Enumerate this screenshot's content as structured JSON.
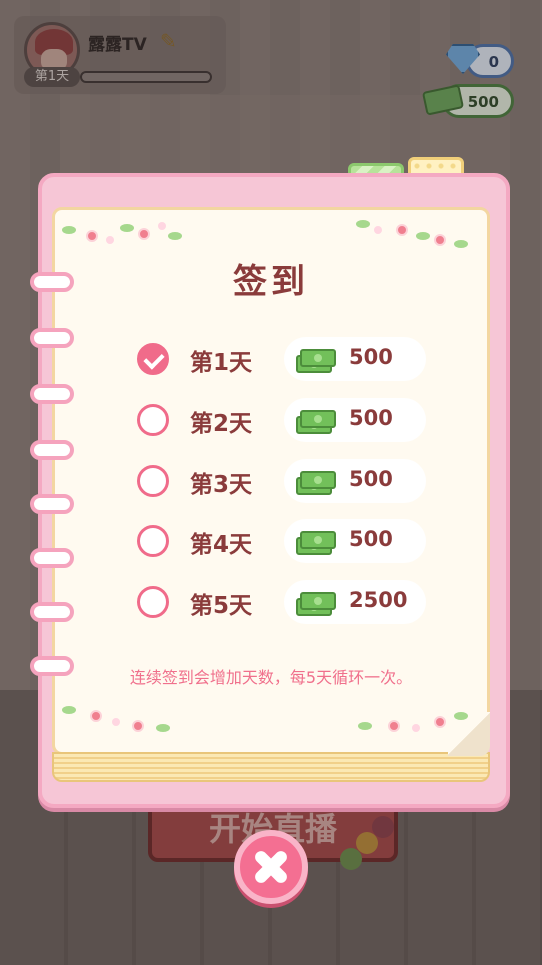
{
  "header": {
    "player_name": "露露TV",
    "day_badge": "第1天",
    "edit_icon": "pencil-icon"
  },
  "currency": {
    "diamonds": "0",
    "cash": "500",
    "diamond_icon": "diamond-icon",
    "cash_icon": "money-icon"
  },
  "background": {
    "start_button_label": "开始直播"
  },
  "dialog": {
    "title": "签到",
    "rows": [
      {
        "day": "第1天",
        "reward": "500",
        "claimed": true
      },
      {
        "day": "第2天",
        "reward": "500",
        "claimed": false
      },
      {
        "day": "第3天",
        "reward": "500",
        "claimed": false
      },
      {
        "day": "第4天",
        "reward": "500",
        "claimed": false
      },
      {
        "day": "第5天",
        "reward": "2500",
        "claimed": false
      }
    ],
    "hint": "连续签到会增加天数，每5天循环一次。",
    "close_icon": "close-icon"
  },
  "colors": {
    "accent_pink": "#f06b8a",
    "text_brown": "#8a3b3b",
    "money_green": "#72c05a"
  }
}
